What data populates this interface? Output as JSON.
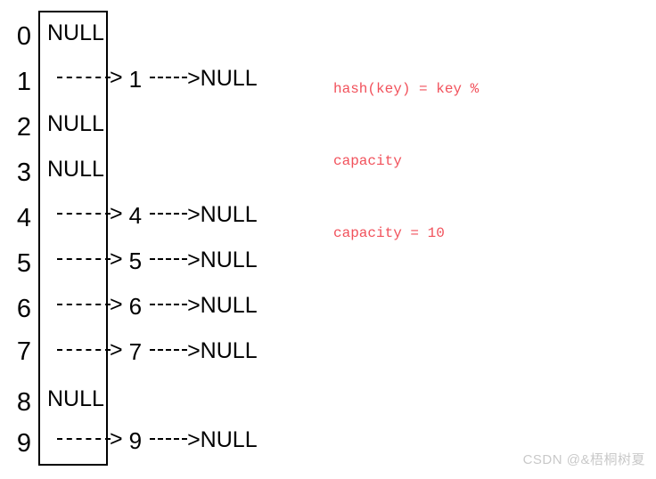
{
  "diagram": {
    "title": "hash-table-separate-chaining",
    "array_box": {
      "border_color": "#000000"
    },
    "null_label": "NULL",
    "arrow_head": ">",
    "buckets": [
      {
        "index": "0",
        "type": "null",
        "null_text": "NULL",
        "key": "",
        "tail": ""
      },
      {
        "index": "1",
        "type": "chain",
        "null_text": "",
        "key": "1",
        "tail": ">NULL"
      },
      {
        "index": "2",
        "type": "null",
        "null_text": "NULL",
        "key": "",
        "tail": ""
      },
      {
        "index": "3",
        "type": "null",
        "null_text": "NULL",
        "key": "",
        "tail": ""
      },
      {
        "index": "4",
        "type": "chain",
        "null_text": "",
        "key": "4",
        "tail": ">NULL"
      },
      {
        "index": "5",
        "type": "chain",
        "null_text": "",
        "key": "5",
        "tail": ">NULL"
      },
      {
        "index": "6",
        "type": "chain",
        "null_text": "",
        "key": "6",
        "tail": ">NULL"
      },
      {
        "index": "7",
        "type": "chain",
        "null_text": "",
        "key": "7",
        "tail": ">NULL"
      },
      {
        "index": "8",
        "type": "null",
        "null_text": "NULL",
        "key": "",
        "tail": ""
      },
      {
        "index": "9",
        "type": "chain",
        "null_text": "",
        "key": "9",
        "tail": ">NULL"
      }
    ]
  },
  "annotation": {
    "color": "#f1515b",
    "line1": "hash(key) = key %",
    "line2": "capacity",
    "line3": "capacity = 10"
  },
  "watermark": {
    "text": "CSDN @&梧桐树夏",
    "color": "#c9c9c9"
  }
}
